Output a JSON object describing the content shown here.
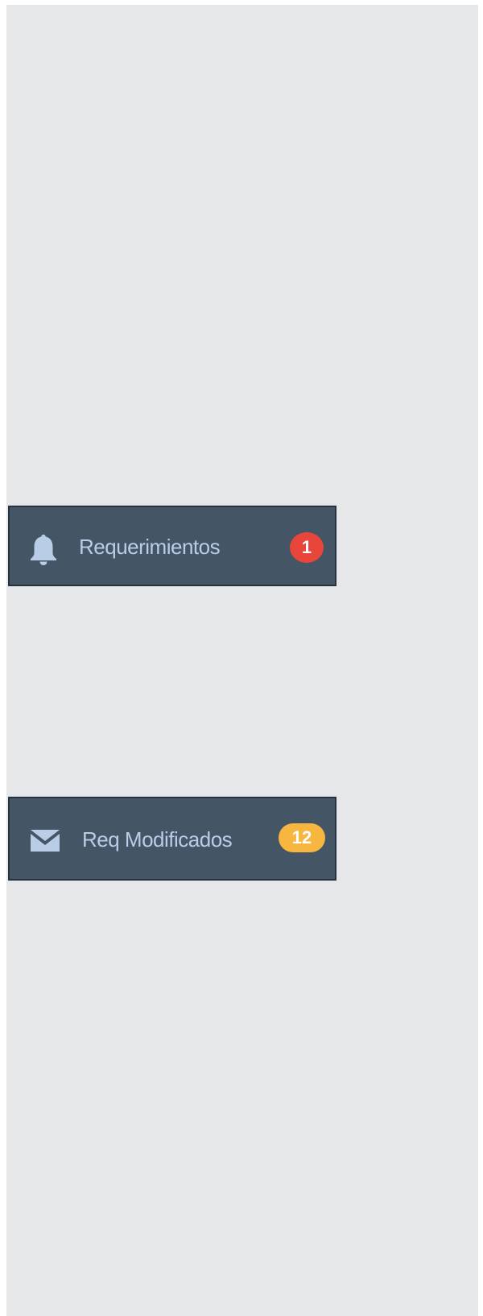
{
  "nav": {
    "items": [
      {
        "label": "Requerimientos",
        "icon": "bell-icon",
        "badge": "1",
        "badge_color": "#e8463a"
      },
      {
        "label": "Req Modificados",
        "icon": "envelope-icon",
        "badge": "12",
        "badge_color": "#f6b640"
      }
    ]
  },
  "colors": {
    "background": "#e6e7e9",
    "item_background": "#445565",
    "item_border": "#26323d",
    "label": "#b9cde6"
  }
}
